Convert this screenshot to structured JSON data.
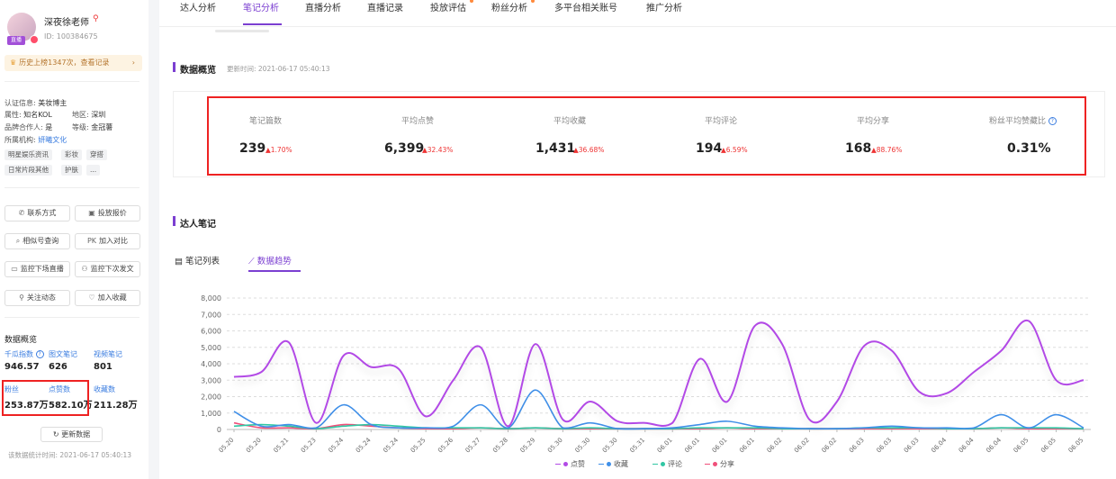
{
  "profile": {
    "name": "深夜徐老师",
    "id": "ID: 100384675",
    "live_badge": "直播",
    "history": "历史上榜1347次，查看记录",
    "cert_label": "认证信息:",
    "cert_value": "美妆博主",
    "attr_label": "属性:",
    "attr_value": "知名KOL",
    "region_label": "地区:",
    "region_value": "深圳",
    "brand_label": "品牌合作人:",
    "brand_value": "是",
    "level_label": "等级:",
    "level_value": "金冠薯",
    "org_label": "所属机构:",
    "org_value": "妍曦文化",
    "tags": [
      "明星娱乐资讯",
      "彩妆",
      "穿搭",
      "日常片段其他",
      "护肤",
      "..."
    ]
  },
  "side_buttons": [
    {
      "icon": "✆",
      "label": "联系方式"
    },
    {
      "icon": "▣",
      "label": "投放报价"
    },
    {
      "icon": "⌕",
      "label": "相似号查询"
    },
    {
      "icon": "PK",
      "label": "加入对比"
    },
    {
      "icon": "▭",
      "label": "监控下场直播"
    },
    {
      "icon": "⚇",
      "label": "监控下次发文"
    },
    {
      "icon": "⚲",
      "label": "关注动态"
    },
    {
      "icon": "♡",
      "label": "加入收藏"
    }
  ],
  "side_stats": {
    "title": "数据概览",
    "items": [
      {
        "label": "千瓜指数",
        "value": "946.57"
      },
      {
        "label": "图文笔记",
        "value": "626"
      },
      {
        "label": "视频笔记",
        "value": "801"
      },
      {
        "label": "粉丝",
        "value": "253.87万"
      },
      {
        "label": "点赞数",
        "value": "582.10万"
      },
      {
        "label": "收藏数",
        "value": "211.28万"
      }
    ],
    "refresh": "更新数据",
    "stat_time": "该数据统计时间: 2021-06-17 05:40:13"
  },
  "tabs": [
    "达人分析",
    "笔记分析",
    "直播分析",
    "直播记录",
    "投放评估",
    "粉丝分析",
    "多平台相关账号",
    "推广分析"
  ],
  "overview": {
    "title": "数据概览",
    "updated": "更新时间: 2021-06-17 05:40:13",
    "metrics": [
      {
        "label": "笔记篇数",
        "value": "239",
        "change": "1.70%"
      },
      {
        "label": "平均点赞",
        "value": "6,399",
        "change": "32.43%"
      },
      {
        "label": "平均收藏",
        "value": "1,431",
        "change": "36.68%"
      },
      {
        "label": "平均评论",
        "value": "194",
        "change": "6.59%"
      },
      {
        "label": "平均分享",
        "value": "168",
        "change": "88.76%"
      },
      {
        "label": "粉丝平均赞藏比",
        "value": "0.31%",
        "change": ""
      }
    ]
  },
  "notes": {
    "title": "达人笔记",
    "subtabs": [
      "笔记列表",
      "数据趋势"
    ]
  },
  "colors": {
    "accent": "#7b3fd1",
    "up": "#e33333"
  },
  "chart_data": {
    "type": "line",
    "categories": [
      "05.20",
      "05.20",
      "05.21",
      "05.23",
      "05.24",
      "05.24",
      "05.24",
      "05.25",
      "05.26",
      "05.27",
      "05.28",
      "05.29",
      "05.30",
      "05.30",
      "05.30",
      "05.31",
      "06.01",
      "06.01",
      "06.01",
      "06.01",
      "06.02",
      "06.02",
      "06.02",
      "06.03",
      "06.03",
      "06.03",
      "06.04",
      "06.04",
      "06.04",
      "06.05",
      "06.05",
      "06.05"
    ],
    "ylim": [
      0,
      8000
    ],
    "yticks": [
      "0",
      "1,000",
      "2,000",
      "3,000",
      "4,000",
      "5,000",
      "6,000",
      "7,000",
      "8,000"
    ],
    "grid": true,
    "legend_position": "bottom-center",
    "series": [
      {
        "name": "点赞",
        "color": "#b24ae6",
        "values": [
          3200,
          3500,
          5300,
          400,
          4500,
          3800,
          3700,
          800,
          3000,
          5000,
          200,
          5200,
          600,
          1700,
          500,
          400,
          400,
          4300,
          1700,
          6300,
          5200,
          600,
          1700,
          5100,
          4800,
          2300,
          2200,
          3500,
          4800,
          6600,
          3000,
          3000
        ]
      },
      {
        "name": "收藏",
        "color": "#3f8fe8",
        "values": [
          1100,
          200,
          300,
          100,
          1500,
          300,
          100,
          100,
          200,
          1500,
          100,
          2400,
          100,
          400,
          50,
          50,
          100,
          300,
          500,
          200,
          100,
          50,
          50,
          100,
          200,
          100,
          100,
          100,
          900,
          100,
          900,
          100
        ]
      },
      {
        "name": "评论",
        "color": "#31c6a3",
        "values": [
          200,
          300,
          200,
          50,
          200,
          300,
          200,
          100,
          100,
          100,
          50,
          100,
          50,
          100,
          50,
          50,
          50,
          100,
          100,
          100,
          50,
          50,
          50,
          100,
          100,
          100,
          50,
          50,
          100,
          100,
          100,
          50
        ]
      },
      {
        "name": "分享",
        "color": "#f04f7a",
        "values": [
          400,
          100,
          100,
          50,
          300,
          200,
          100,
          50,
          50,
          100,
          50,
          100,
          50,
          50,
          50,
          50,
          50,
          50,
          100,
          50,
          50,
          50,
          50,
          50,
          50,
          50,
          50,
          50,
          100,
          50,
          50,
          50
        ]
      }
    ]
  }
}
